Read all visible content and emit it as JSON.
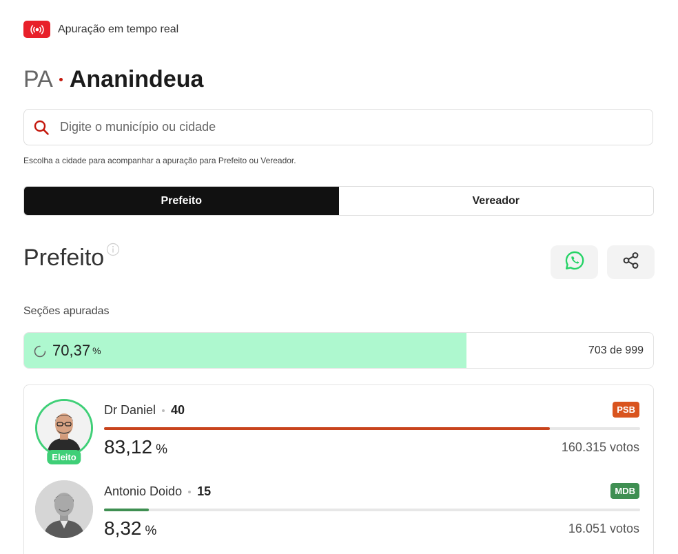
{
  "live": {
    "label": "Apuração em tempo real",
    "color": "#e8202a"
  },
  "location": {
    "state": "PA",
    "city": "Ananindeua"
  },
  "search": {
    "placeholder": "Digite o município ou cidade",
    "value": "",
    "hint": "Escolha a cidade para acompanhar a apuração para Prefeito ou Vereador."
  },
  "tabs": [
    {
      "label": "Prefeito",
      "active": true
    },
    {
      "label": "Vereador",
      "active": false
    }
  ],
  "section": {
    "title": "Prefeito"
  },
  "progress": {
    "label": "Seções apuradas",
    "percent_text": "70,37",
    "percent_sign": "%",
    "percent_value": 70.37,
    "count_text": "703 de 999",
    "fill_color": "#aef8cf"
  },
  "candidates": [
    {
      "name": "Dr Daniel",
      "number": "40",
      "party": "PSB",
      "party_color": "#d9541e",
      "percent_text": "83,12",
      "percent_sign": "%",
      "percent_value": 83.12,
      "votes": "160.315 votos",
      "elected": true,
      "elected_label": "Eleito",
      "bar_color": "#c8441d"
    },
    {
      "name": "Antonio Doido",
      "number": "15",
      "party": "MDB",
      "party_color": "#3f8f52",
      "percent_text": "8,32",
      "percent_sign": "%",
      "percent_value": 8.32,
      "votes": "16.051 votos",
      "elected": false,
      "bar_color": "#3f8f52"
    }
  ]
}
